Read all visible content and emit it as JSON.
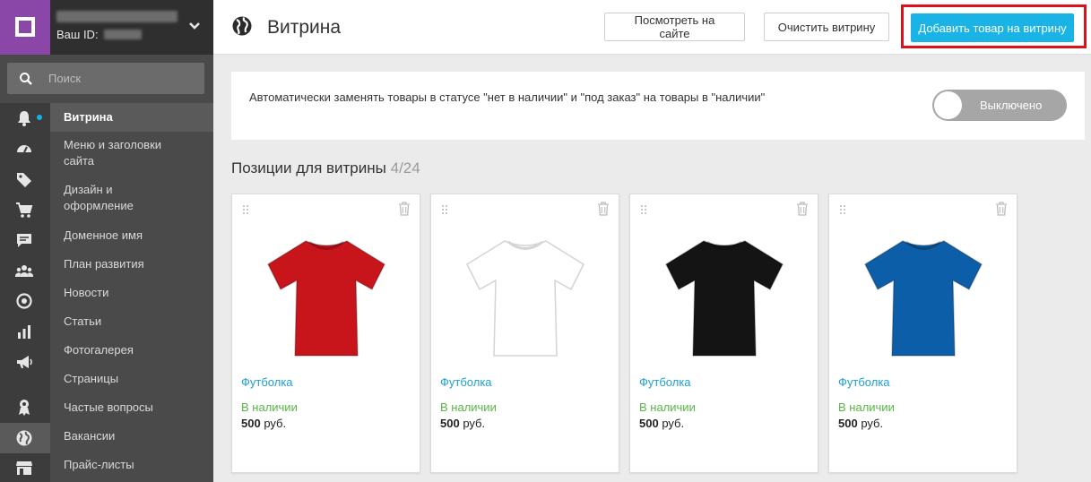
{
  "account": {
    "id_label": "Ваш ID:"
  },
  "search": {
    "placeholder": "Поиск"
  },
  "sidebar": {
    "items": [
      {
        "label": "Витрина",
        "active": true
      },
      {
        "label": "Меню и заголовки сайта"
      },
      {
        "label": "Дизайн и оформление"
      },
      {
        "label": "Доменное имя"
      },
      {
        "label": "План развития"
      },
      {
        "label": "Новости"
      },
      {
        "label": "Статьи"
      },
      {
        "label": "Фотогалерея"
      },
      {
        "label": "Страницы"
      },
      {
        "label": "Частые вопросы"
      },
      {
        "label": "Вакансии"
      },
      {
        "label": "Прайс-листы"
      }
    ],
    "icons": [
      "bell-icon",
      "dashboard-icon",
      "tag-icon",
      "cart-icon",
      "chat-icon",
      "users-icon",
      "target-icon",
      "bar-chart-icon",
      "megaphone-icon",
      "award-icon",
      "globe-icon",
      "store-icon"
    ]
  },
  "header": {
    "title": "Витрина",
    "view_site": "Посмотреть на сайте",
    "clear": "Очистить витрину",
    "add_product": "Добавить товар на витрину"
  },
  "settings": {
    "auto_replace_text": "Автоматически заменять товары в статусе \"нет в наличии\" и \"под заказ\" на товары в \"наличии\"",
    "toggle_state": "Выключено"
  },
  "positions": {
    "title": "Позиции для витрины",
    "count": "4/24",
    "items": [
      {
        "name": "Футболка",
        "stock": "В наличии",
        "price": "500",
        "currency": "руб.",
        "color": "#c8141b"
      },
      {
        "name": "Футболка",
        "stock": "В наличии",
        "price": "500",
        "currency": "руб.",
        "color": "#ffffff"
      },
      {
        "name": "Футболка",
        "stock": "В наличии",
        "price": "500",
        "currency": "руб.",
        "color": "#141414"
      },
      {
        "name": "Футболка",
        "stock": "В наличии",
        "price": "500",
        "currency": "руб.",
        "color": "#0d5ea9"
      }
    ]
  },
  "colors": {
    "accent": "#19b3e6",
    "logo": "#8a47a8",
    "highlight": "#e0101a",
    "in_stock": "#59b646",
    "link": "#1e9fd3"
  }
}
